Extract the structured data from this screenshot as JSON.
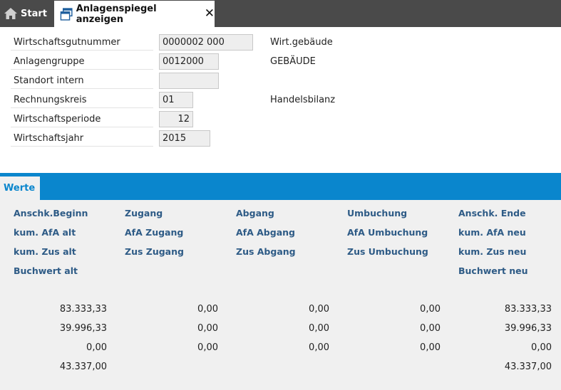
{
  "tabs": {
    "start_label": "Start",
    "active_label": "Anlagenspiegel anzeigen"
  },
  "form": {
    "wirtschaftsgutnummer": {
      "label": "Wirtschaftsgutnummer",
      "value": "0000002 000",
      "desc": "Wirt.gebäude"
    },
    "anlagengruppe": {
      "label": "Anlagengruppe",
      "value": "0012000",
      "desc": "GEBÄUDE"
    },
    "standort": {
      "label": "Standort intern",
      "value": ""
    },
    "rechnungskreis": {
      "label": "Rechnungskreis",
      "value": "01",
      "desc": "Handelsbilanz"
    },
    "periode": {
      "label": "Wirtschaftsperiode",
      "value": "12"
    },
    "jahr": {
      "label": "Wirtschaftsjahr",
      "value": "2015"
    }
  },
  "werte": {
    "tab_label": "Werte",
    "columns": [
      {
        "headers": [
          "Anschk.Beginn",
          "kum. AfA alt",
          "kum. Zus alt",
          "Buchwert alt"
        ],
        "values": [
          "83.333,33",
          "39.996,33",
          "0,00",
          "43.337,00"
        ]
      },
      {
        "headers": [
          "Zugang",
          "AfA Zugang",
          "Zus Zugang"
        ],
        "values": [
          "0,00",
          "0,00",
          "0,00"
        ]
      },
      {
        "headers": [
          "Abgang",
          "AfA Abgang",
          "Zus Abgang"
        ],
        "values": [
          "0,00",
          "0,00",
          "0,00"
        ]
      },
      {
        "headers": [
          "Umbuchung",
          "AfA Umbuchung",
          "Zus Umbuchung"
        ],
        "values": [
          "0,00",
          "0,00",
          "0,00"
        ]
      },
      {
        "headers": [
          "Anschk. Ende",
          "kum. AfA neu",
          "kum. Zus neu",
          "Buchwert neu"
        ],
        "values": [
          "83.333,33",
          "39.996,33",
          "0,00",
          "43.337,00"
        ]
      }
    ]
  }
}
